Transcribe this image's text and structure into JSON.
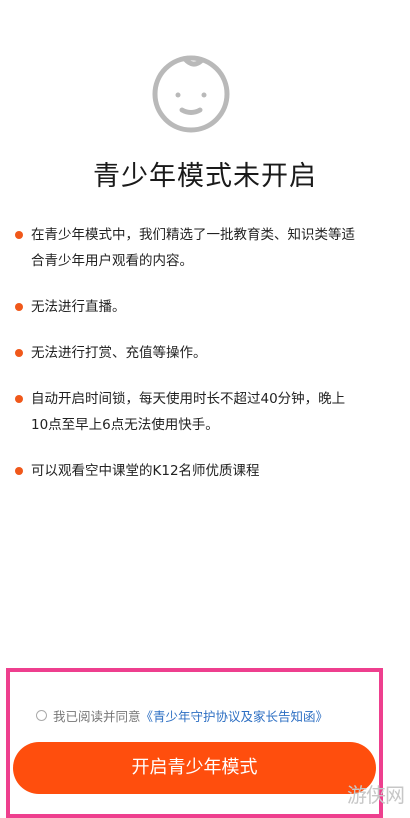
{
  "icon": "baby-face-icon",
  "title": "青少年模式未开启",
  "bullets": [
    {
      "line1": "在青少年模式中，我们精选了一批教育类、知识类等适",
      "line2": "合青少年用户观看的内容。"
    },
    {
      "line1": "无法进行直播。",
      "line2": ""
    },
    {
      "line1": "无法进行打赏、充值等操作。",
      "line2": ""
    },
    {
      "line1": "自动开启时间锁，每天使用时长不超过40分钟，晚上",
      "line2": "10点至早上6点无法使用快手。"
    },
    {
      "line1": "可以观看空中课堂的K12名师优质课程",
      "line2": ""
    }
  ],
  "agreement": {
    "prefix": "我已阅读并同意",
    "link": "《青少年守护协议及家长告知函》"
  },
  "cta_label": "开启青少年模式",
  "watermark": "游侠网",
  "colors": {
    "accent": "#ff4e0d",
    "highlight_border": "#ee3f8e",
    "link": "#2d6fc3"
  }
}
